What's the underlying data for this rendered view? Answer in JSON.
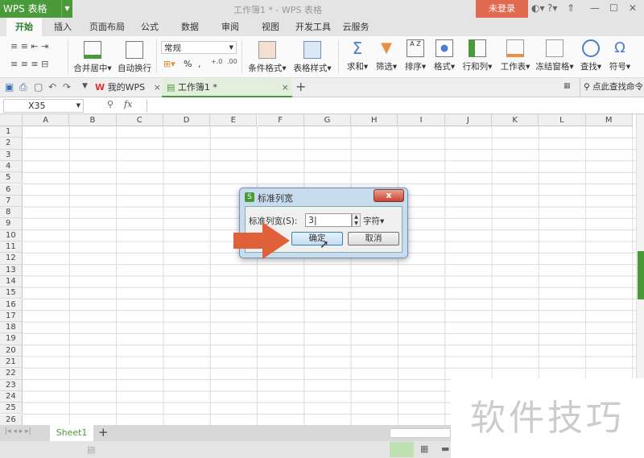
{
  "app": {
    "logo": "WPS 表格",
    "window_title": "工作簿1 * - WPS 表格",
    "login": "未登录"
  },
  "ribbon_tabs": [
    "开始",
    "插入",
    "页面布局",
    "公式",
    "数据",
    "审阅",
    "视图",
    "开发工具",
    "云服务"
  ],
  "ribbon": {
    "merge": "合并居中",
    "wrap": "自动换行",
    "number_format": "常规",
    "percent": "%",
    "comma": ",",
    "cond_format": "条件格式",
    "table_style": "表格样式",
    "sum": "求和",
    "filter": "筛选",
    "sort": "排序",
    "format": "格式",
    "rowcol": "行和列",
    "sheet": "工作表",
    "freeze": "冻结窗格",
    "find": "查找",
    "symbol": "符号"
  },
  "doc_tabs": [
    {
      "label": "我的WPS"
    },
    {
      "label": "工作簿1 *"
    }
  ],
  "search_cmd": "点此查找命令",
  "name_box": "X35",
  "fx": "fx",
  "columns": [
    "A",
    "B",
    "C",
    "D",
    "E",
    "F",
    "G",
    "H",
    "I",
    "J",
    "K",
    "L",
    "M"
  ],
  "rows": [
    "1",
    "2",
    "3",
    "4",
    "5",
    "6",
    "7",
    "8",
    "9",
    "10",
    "11",
    "12",
    "13",
    "14",
    "15",
    "16",
    "17",
    "18",
    "19",
    "20",
    "21",
    "22",
    "23",
    "24",
    "25",
    "26"
  ],
  "sheet_tab": "Sheet1",
  "dialog": {
    "title": "标准列宽",
    "label": "标准列宽(S):",
    "value": "3",
    "unit": "字符",
    "ok": "确定",
    "cancel": "取消",
    "close": "x"
  },
  "watermark": "软件技巧",
  "colors": {
    "green": "#4a9a3a",
    "login": "#e06a50",
    "arrow": "#e0603a"
  }
}
